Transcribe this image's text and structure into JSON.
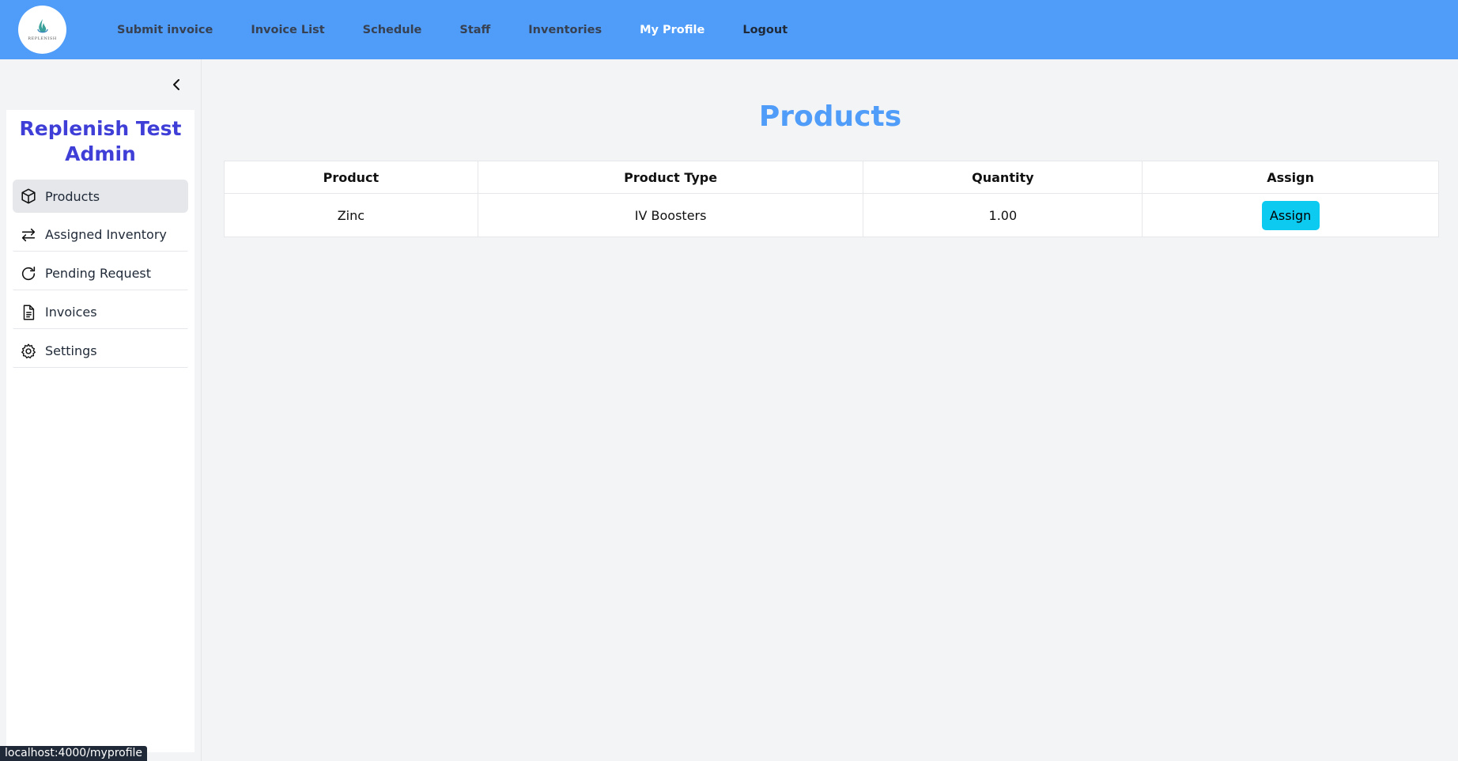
{
  "brand": {
    "logo_text": "REPLENISH"
  },
  "nav": {
    "items": [
      {
        "label": "Submit invoice"
      },
      {
        "label": "Invoice List"
      },
      {
        "label": "Schedule"
      },
      {
        "label": "Staff"
      },
      {
        "label": "Inventories"
      },
      {
        "label": "My Profile"
      },
      {
        "label": "Logout"
      }
    ]
  },
  "sidebar": {
    "title": "Replenish Test Admin",
    "collapse_icon": "chevron-left-icon",
    "items": [
      {
        "label": "Products",
        "icon": "box-icon",
        "active": true
      },
      {
        "label": "Assigned Inventory",
        "icon": "arrows-left-right-icon"
      },
      {
        "label": "Pending Request",
        "icon": "refresh-icon"
      },
      {
        "label": "Invoices",
        "icon": "document-icon"
      },
      {
        "label": "Settings",
        "icon": "gear-icon"
      }
    ]
  },
  "main": {
    "title": "Products",
    "table": {
      "headers": [
        "Product",
        "Product Type",
        "Quantity",
        "Assign"
      ],
      "rows": [
        {
          "product": "Zinc",
          "type": "IV Boosters",
          "quantity": "1.00",
          "action": "Assign"
        }
      ]
    }
  },
  "status_bar": {
    "url": "localhost:4000/myprofile"
  },
  "colors": {
    "topbar": "#4f9cf9",
    "title": "#4f9cf9",
    "sidebar_title": "#3f3fd8",
    "assign_button": "#0dcaf0"
  }
}
